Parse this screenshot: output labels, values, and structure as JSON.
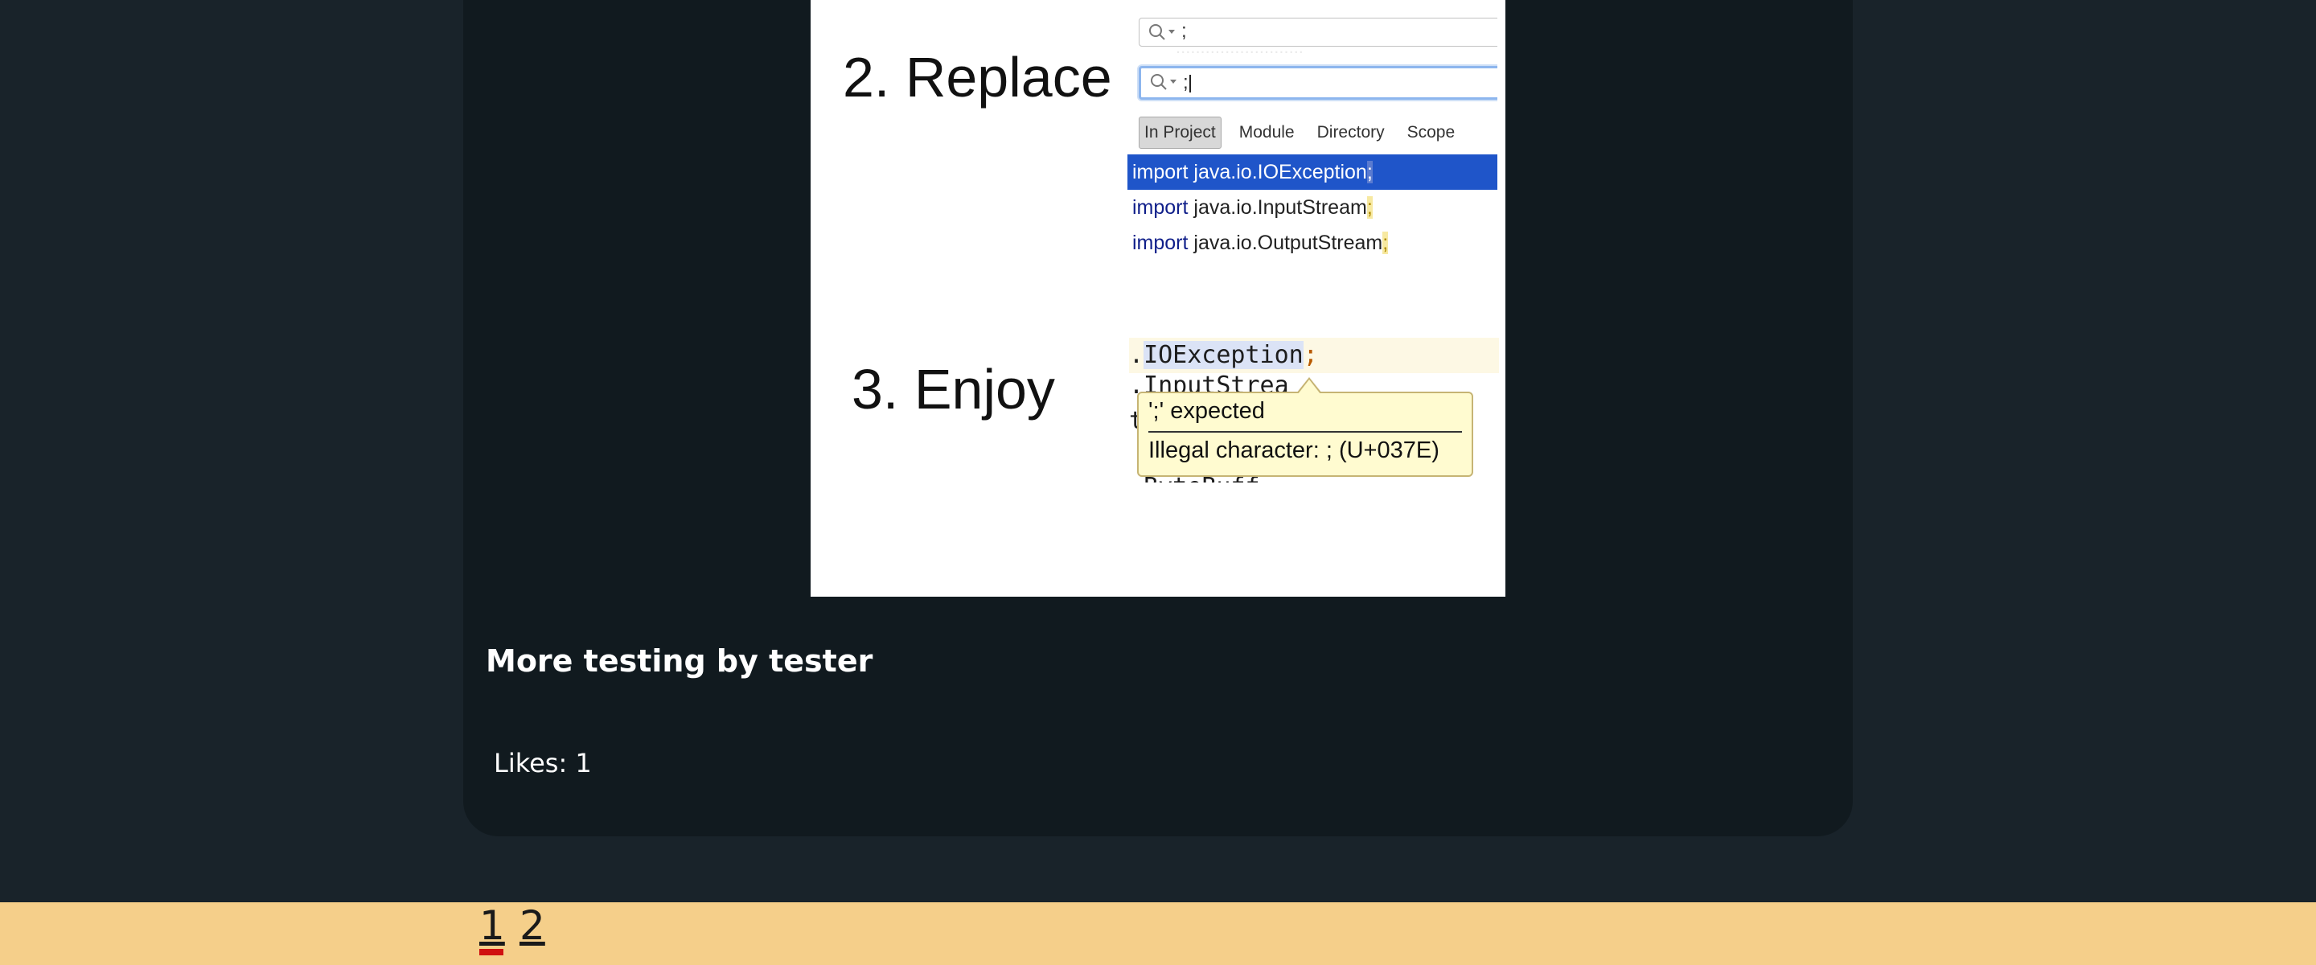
{
  "post": {
    "title": "More testing by tester",
    "likes": "Likes: 1"
  },
  "meme": {
    "step2_label": "2. Replace",
    "step3_label": "3. Enjoy",
    "find_value": ";",
    "replace_value": ";",
    "scopes": [
      "In Project",
      "Module",
      "Directory",
      "Scope"
    ],
    "results": [
      {
        "keyword": "import",
        "text": "java.io.IOException",
        "semi": ";",
        "selected": true
      },
      {
        "keyword": "import",
        "text": "java.io.InputStream",
        "semi": ";",
        "selected": false
      },
      {
        "keyword": "import",
        "text": "java.io.OutputStream",
        "semi": ";",
        "selected": false
      }
    ],
    "code_line": {
      "prefix": ".",
      "highlighted": "IOException",
      "suffix": ";"
    },
    "tooltip": {
      "line1": "';' expected",
      "line2": "Illegal character: ; (U+037E)"
    }
  },
  "pagination": {
    "pages": [
      "1",
      "2"
    ],
    "current": "1"
  },
  "colors": {
    "page_bg": "#19232a",
    "card_bg": "#111a1f",
    "footer_bg": "#f5cf8a",
    "current_page_marker": "#d01010",
    "ide_selection": "#1f55c9"
  }
}
